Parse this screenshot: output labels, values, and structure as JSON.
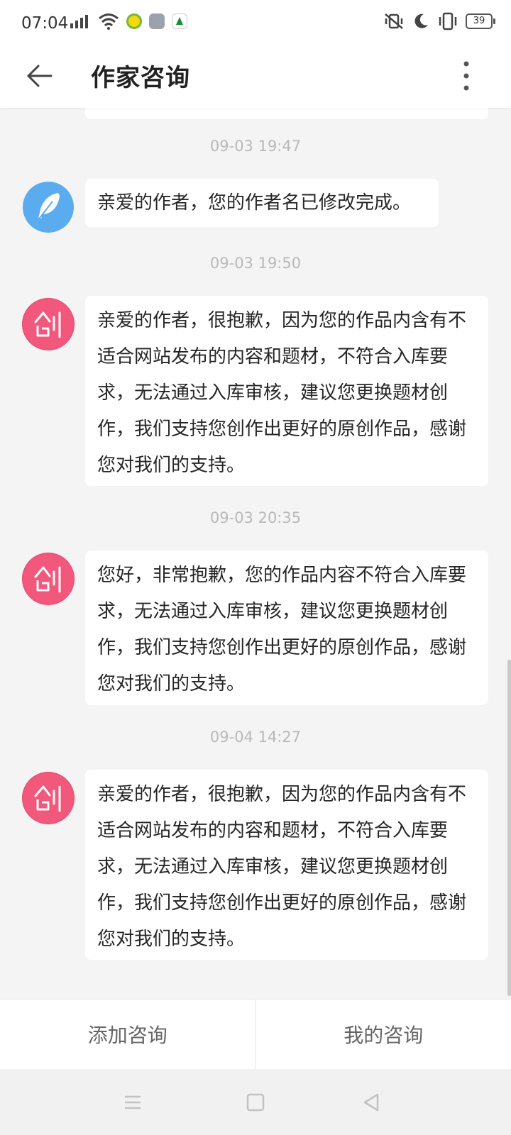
{
  "status_bar": {
    "time": "07:04",
    "battery": "39",
    "icons": [
      "signal-icon",
      "wifi-icon",
      "app-icon-1",
      "app-icon-2",
      "app-icon-3",
      "vibrate-icon",
      "moon-icon",
      "phone-vibrate-icon",
      "battery-icon"
    ]
  },
  "header": {
    "title": "作家咨询"
  },
  "messages": [
    {
      "timestamp": "09-03 19:47",
      "avatar": "feather-icon",
      "text": "亲爱的作者，您的作者名已修改完成。"
    },
    {
      "timestamp": "09-03 19:50",
      "avatar": "chuang-icon",
      "text": "亲爱的作者，很抱歉，因为您的作品内含有不适合网站发布的内容和题材，不符合入库要求，无法通过入库审核，建议您更换题材创作，我们支持您创作出更好的原创作品，感谢您对我们的支持。"
    },
    {
      "timestamp": "09-03 20:35",
      "avatar": "chuang-icon",
      "text": "您好，非常抱歉，您的作品内容不符合入库要求，无法通过入库审核，建议您更换题材创作，我们支持您创作出更好的原创作品，感谢您对我们的支持。"
    },
    {
      "timestamp": "09-04 14:27",
      "avatar": "chuang-icon",
      "text": "亲爱的作者，很抱歉，因为您的作品内含有不适合网站发布的内容和题材，不符合入库要求，无法通过入库审核，建议您更换题材创作，我们支持您创作出更好的原创作品，感谢您对我们的支持。"
    }
  ],
  "tabs": {
    "add": "添加咨询",
    "mine": "我的咨询"
  },
  "colors": {
    "background": "#f4f4f4",
    "avatar_blue": "#5aacef",
    "avatar_pink": "#f2577c"
  }
}
